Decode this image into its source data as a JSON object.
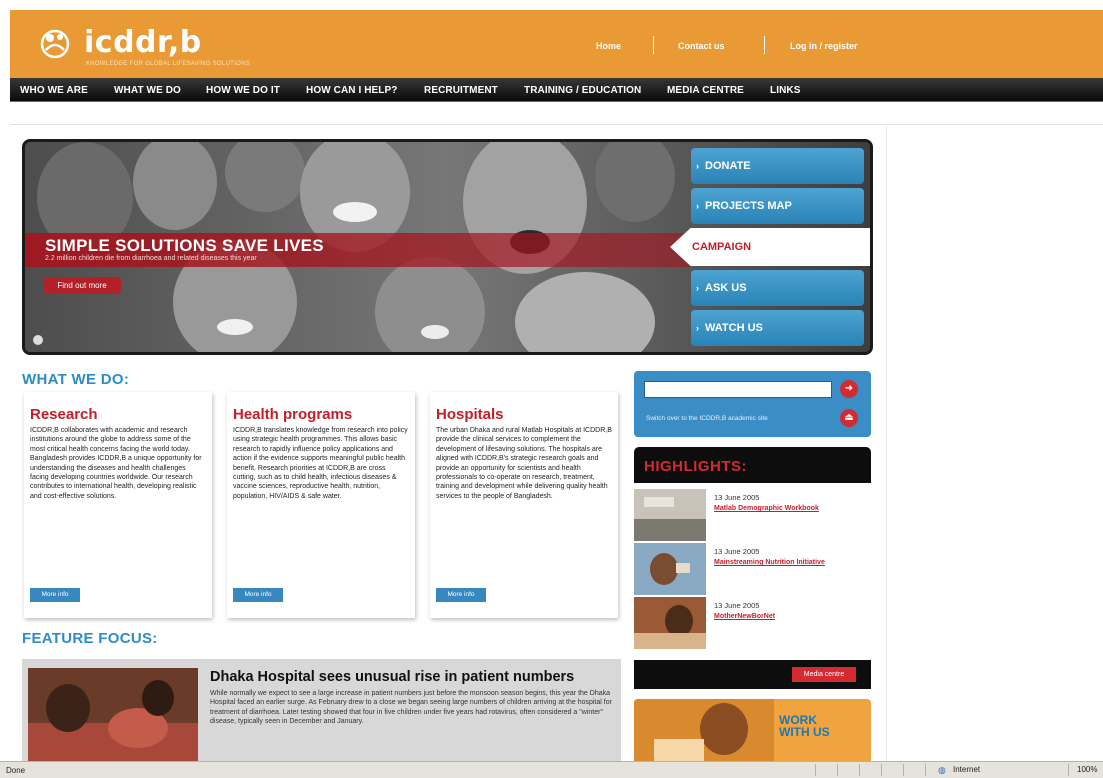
{
  "header": {
    "logo_text": "icddr,b",
    "tagline": "KNOWLEDGE FOR GLOBAL LIFESAVING SOLUTIONS",
    "links": [
      "Home",
      "Contact us",
      "Log in / register"
    ]
  },
  "nav": {
    "items": [
      "WHO WE ARE",
      "WHAT WE DO",
      "HOW WE DO IT",
      "HOW CAN I HELP?",
      "RECRUITMENT",
      "TRAINING / EDUCATION",
      "MEDIA CENTRE",
      "LINKS"
    ]
  },
  "hero": {
    "title": "SIMPLE SOLUTIONS SAVE LIVES",
    "subtitle": "2.2 million children die from diarrhoea and related diseases this year",
    "button": "Find out more",
    "side_buttons": [
      "DONATE",
      "PROJECTS MAP",
      "ASK US",
      "WATCH US"
    ],
    "campaign": "CAMPAIGN"
  },
  "what_we_do": {
    "heading": "WHAT WE DO:",
    "cards": [
      {
        "title": "Research",
        "body": "ICDDR,B collaborates with academic and research institutions around the globe to address some of the most critical health concerns facing the world today. Bangladesh provides ICDDR,B a unique opportunity for understanding the diseases and health challenges facing developing countries worldwide. Our research contributes to international health, developing realistic and cost-effective solutions.",
        "more": "More info"
      },
      {
        "title": "Health programs",
        "body": "ICDDR,B translates knowledge from research into policy using strategic health programmes. This allows basic research to rapidly influence policy applications and action if the evidence supports meaningful public health benefit. Research priorities at ICDDR,B are cross cutting, such as to child health, infectious diseases & vaccine sciences, reproductive health, nutrition, population, HIV/AIDS & safe water.",
        "more": "More info"
      },
      {
        "title": "Hospitals",
        "body": "The urban Dhaka and rural Matlab Hospitals at ICDDR,B provide the clinical services to complement the development of lifesaving solutions. The hospitals are aligned with ICDDR,B's strategic research goals and provide an opportunity for scientists and health professionals to co-operate on research, treatment, training and development while delivering quality health services to the people of Bangladesh.",
        "more": "More info"
      }
    ]
  },
  "feature_focus": {
    "heading": "FEATURE FOCUS:",
    "title": "Dhaka Hospital sees unusual rise in patient numbers",
    "body": "While normally we expect to see a large increase in patient numbers just before the monsoon season begins, this year the Dhaka Hospital faced an earlier surge. As February drew to a close we began seeing large numbers of children arriving at the hospital for treatment of diarrhoea. Later testing showed that four in five children under five years had rotavirus, often considered a \"winter\" disease, typically seen in December and January."
  },
  "search": {
    "placeholder": "",
    "switch_text": "Switch over to the ICDDR,B academic site"
  },
  "highlights": {
    "heading": "HIGHLIGHTS:",
    "items": [
      {
        "date": "13 June 2005",
        "title": "Matlab Demographic Workbook"
      },
      {
        "date": "13 June 2005",
        "title": "Mainstreaming Nutrition Initiative"
      },
      {
        "date": "13 June 2005",
        "title": "MotherNewBorNet"
      }
    ],
    "media_button": "Media centre"
  },
  "work_with_us": "WORK WITH US",
  "status_bar": {
    "left": "Done",
    "zone": "Internet",
    "zoom": "100%"
  },
  "colors": {
    "brand_orange": "#e99a35",
    "accent_blue": "#2e8cc8",
    "accent_red": "#c41e2a",
    "nav_black": "#0d0d0d"
  }
}
